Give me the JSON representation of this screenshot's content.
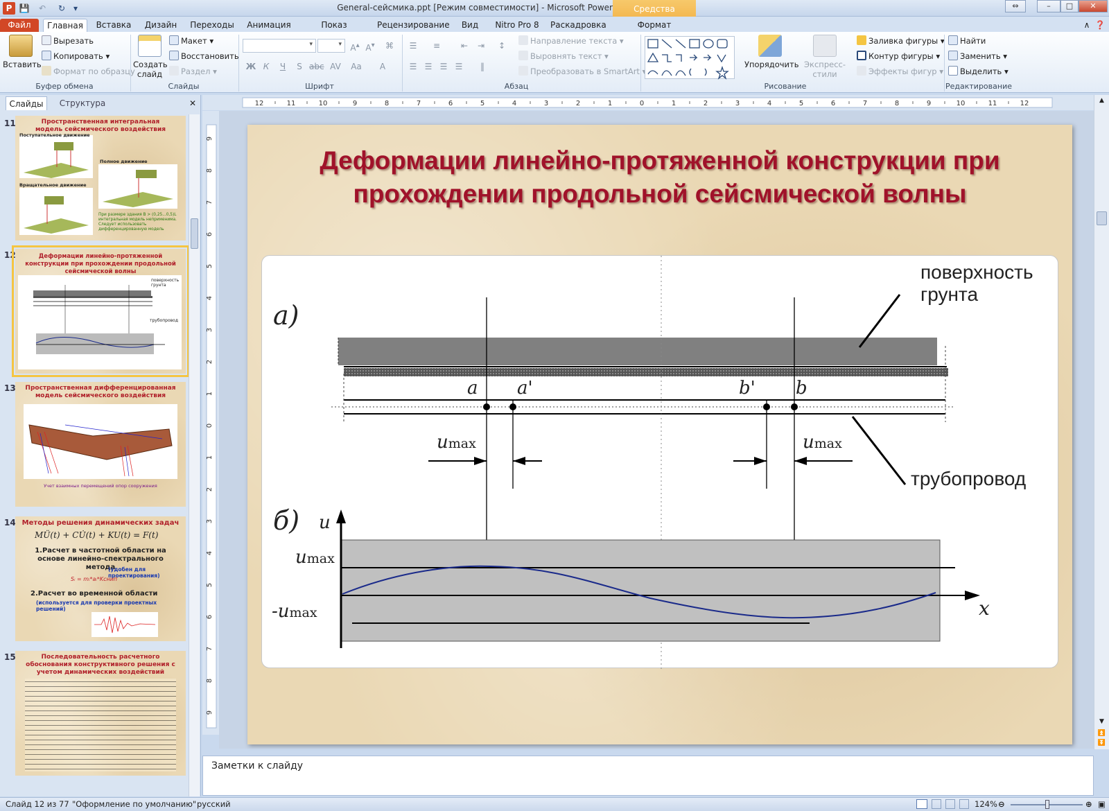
{
  "window": {
    "title": "General-сейсмика.ppt [Режим совместимости]  -  Microsoft PowerPoint",
    "context_group": "Средства рисования"
  },
  "tabs": [
    "Файл",
    "Главная",
    "Вставка",
    "Дизайн",
    "Переходы",
    "Анимация",
    "Показ слайдов",
    "Рецензирование",
    "Вид",
    "Nitro Pro 8",
    "Раскадровка",
    "Формат"
  ],
  "ribbon": {
    "clipboard": {
      "paste": "Вставить",
      "cut": "Вырезать",
      "copy": "Копировать",
      "format_painter": "Формат по образцу",
      "label": "Буфер обмена"
    },
    "slides": {
      "new_slide": "Создать слайд",
      "layout": "Макет",
      "reset": "Восстановить",
      "section": "Раздел",
      "label": "Слайды"
    },
    "font": {
      "label": "Шрифт"
    },
    "paragraph": {
      "text_direction": "Направление текста",
      "align_text": "Выровнять текст",
      "smartart": "Преобразовать в SmartArt",
      "label": "Абзац"
    },
    "drawing": {
      "arrange": "Упорядочить",
      "quick_styles": "Экспресс-стили",
      "fill": "Заливка фигуры",
      "outline": "Контур фигуры",
      "effects": "Эффекты фигур",
      "label": "Рисование"
    },
    "editing": {
      "find": "Найти",
      "replace": "Заменить",
      "select": "Выделить",
      "label": "Редактирование"
    }
  },
  "left_panel": {
    "tab_slides": "Слайды",
    "tab_outline": "Структура",
    "thumbs": [
      {
        "num": "11",
        "title": "Пространственная  интегральная  модель сейсмического воздействия",
        "cap1": "Поступательное движение",
        "cap2": "Полное движение",
        "cap3": "Вращательное движение",
        "note": "При размере здания B > (0,25...0,5)L интегральная модель неприменима. Следует использовать дифференцированную модель"
      },
      {
        "num": "12",
        "title": "Деформации линейно-протяженной конструкции при прохождении продольной сейсмической волны",
        "l1": "поверхность грунта",
        "l2": "трубопровод"
      },
      {
        "num": "13",
        "title": "Пространственная  дифференцированная модель сейсмического воздействия",
        "caption": "Учет взаимных перемещений опор сооружения"
      },
      {
        "num": "14",
        "title": "Методы решения динамических задач",
        "equation": "MÜ(t) + CU̇(t) + KU(t) = F(t)",
        "item1": "1.Расчет в частотной области на основе линейно-спектрального метода",
        "item1_note": "(удобен для проектирования)",
        "formula": "Sᵢ = mᵢ*aᵢ*Kснип",
        "item2": "2.Расчет во временной  области",
        "item2_note": "(используется  для проверки проектных решений)"
      },
      {
        "num": "15",
        "title": "Последовательность  расчетного обоснования конструктивного решения с учетом динамических  воздействий"
      }
    ]
  },
  "ruler": {
    "h_ticks": [
      "12",
      "11",
      "10",
      "9",
      "8",
      "7",
      "6",
      "5",
      "4",
      "3",
      "2",
      "1",
      "0",
      "1",
      "2",
      "3",
      "4",
      "5",
      "6",
      "7",
      "8",
      "9",
      "10",
      "11",
      "12"
    ],
    "v_ticks": [
      "9",
      "8",
      "7",
      "6",
      "5",
      "4",
      "3",
      "2",
      "1",
      "0",
      "1",
      "2",
      "3",
      "4",
      "5",
      "6",
      "7",
      "8",
      "9"
    ]
  },
  "slide": {
    "title_line1": "Деформации линейно-протяженной конструкции при",
    "title_line2": "прохождении продольной сейсмической волны",
    "diagram": {
      "label_a": "а)",
      "label_b": "б)",
      "surface_label_1": "поверхность",
      "surface_label_2": "грунта",
      "pipe_label": "трубопровод",
      "pt_a": "a",
      "pt_a_prime": "a'",
      "pt_b_prime": "b'",
      "pt_b": "b",
      "umax": "u",
      "umax_sub": "max",
      "axis_u": "u",
      "axis_x": "x",
      "neg_umax": "-u"
    }
  },
  "notes": {
    "text": "Заметки к слайду"
  },
  "status": {
    "slide_counter": "Слайд 12 из 77",
    "theme": "\"Оформление по умолчанию\"",
    "language": "русский",
    "zoom": "124%"
  }
}
